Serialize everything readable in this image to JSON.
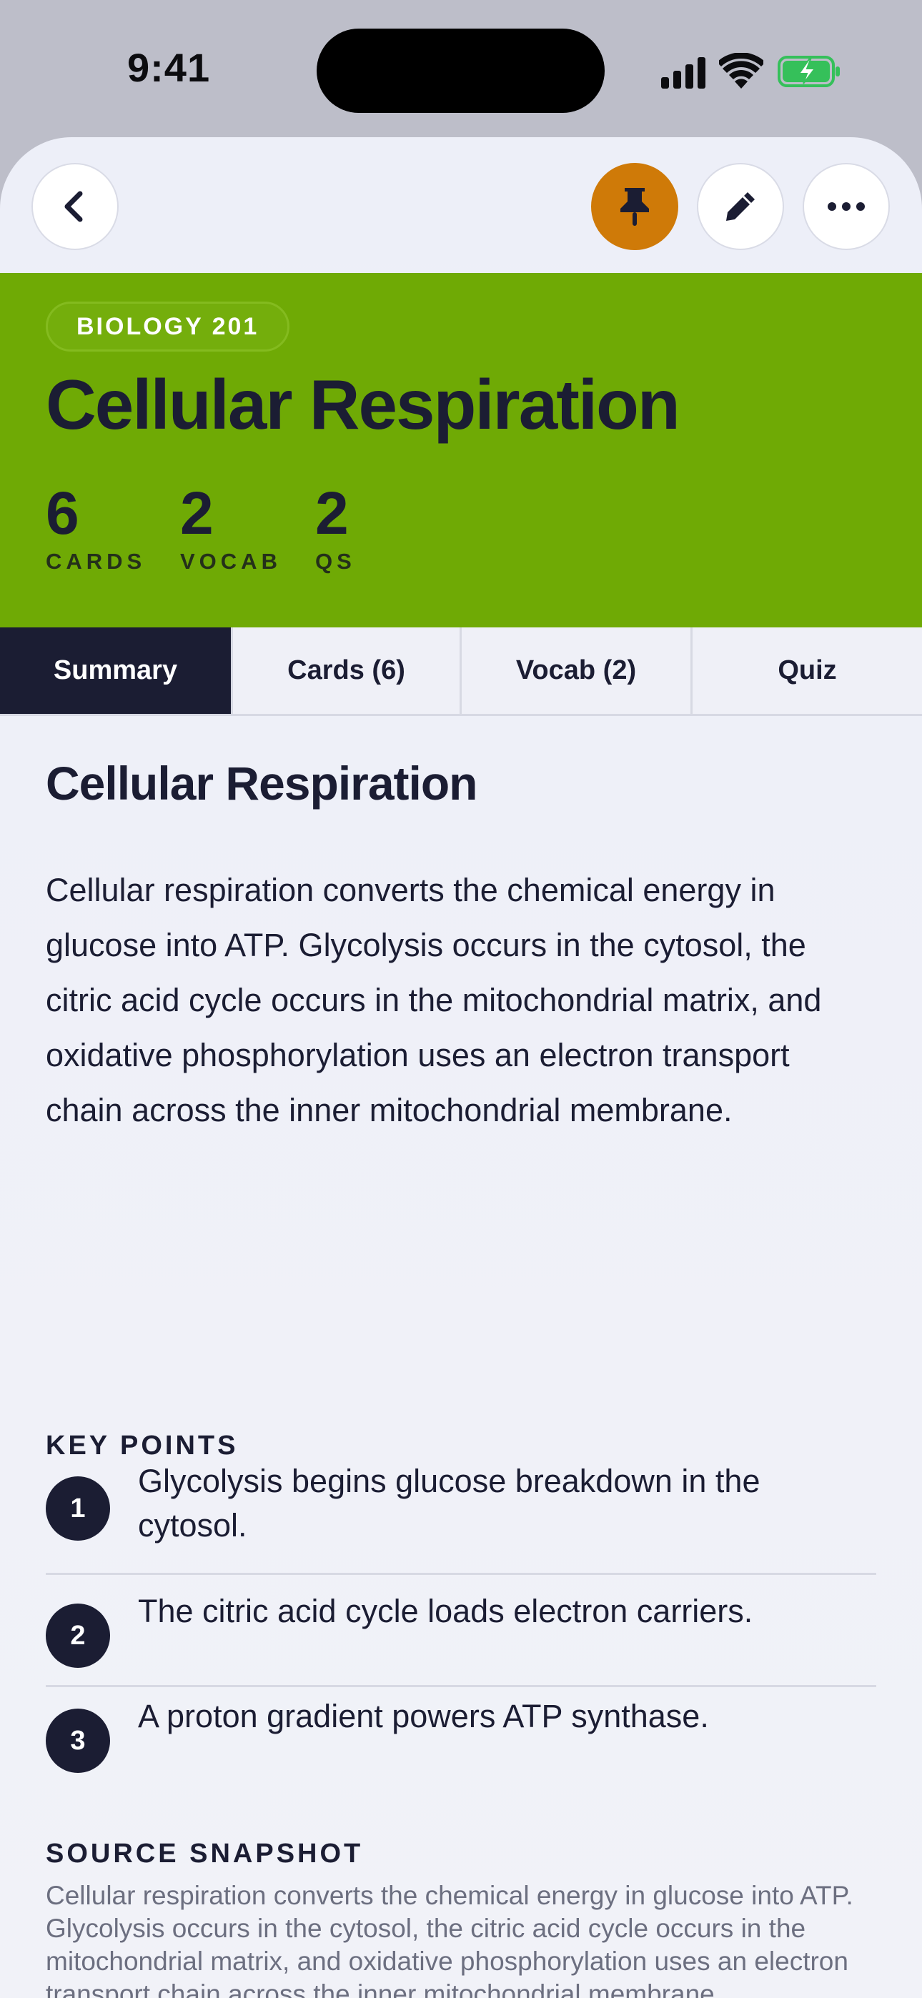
{
  "status_bar": {
    "time": "9:41",
    "icons": [
      "signal-icon",
      "wifi-icon",
      "battery-charging-icon"
    ]
  },
  "nav": {
    "buttons": [
      "back-chevron-icon",
      "pin-icon",
      "pencil-icon",
      "more-ellipsis-icon"
    ],
    "pin_active_color": "#cf7a08"
  },
  "hero": {
    "badge": "BIOLOGY 201",
    "title": "Cellular Respiration",
    "background_color": "#6faa05",
    "stats": [
      {
        "value": "6",
        "label": "CARDS"
      },
      {
        "value": "2",
        "label": "VOCAB"
      },
      {
        "value": "2",
        "label": "QS"
      }
    ]
  },
  "tabs": [
    {
      "label": "Summary",
      "active": true
    },
    {
      "label": "Cards (6)",
      "active": false
    },
    {
      "label": "Vocab (2)",
      "active": false
    },
    {
      "label": "Quiz",
      "active": false
    }
  ],
  "summary": {
    "title": "Cellular Respiration",
    "body": "Cellular respiration converts the chemical energy in glucose into ATP. Glycolysis occurs in the cytosol, the citric acid cycle occurs in the mitochondrial matrix, and oxidative phosphorylation uses an electron transport chain across the inner mitochondrial membrane."
  },
  "key_points": {
    "heading": "KEY POINTS",
    "items": [
      {
        "number": "1",
        "text": "Glycolysis begins glucose breakdown in the cytosol."
      },
      {
        "number": "2",
        "text": "The citric acid cycle loads electron carriers."
      },
      {
        "number": "3",
        "text": "A proton gradient powers ATP synthase."
      }
    ]
  },
  "source_snapshot": {
    "heading": "SOURCE SNAPSHOT",
    "text": "Cellular respiration converts the chemical energy in glucose into ATP. Glycolysis occurs in the cytosol, the citric acid cycle occurs in the mitochondrial matrix, and oxidative phosphorylation uses an electron transport chain across the inner mitochondrial membrane."
  }
}
